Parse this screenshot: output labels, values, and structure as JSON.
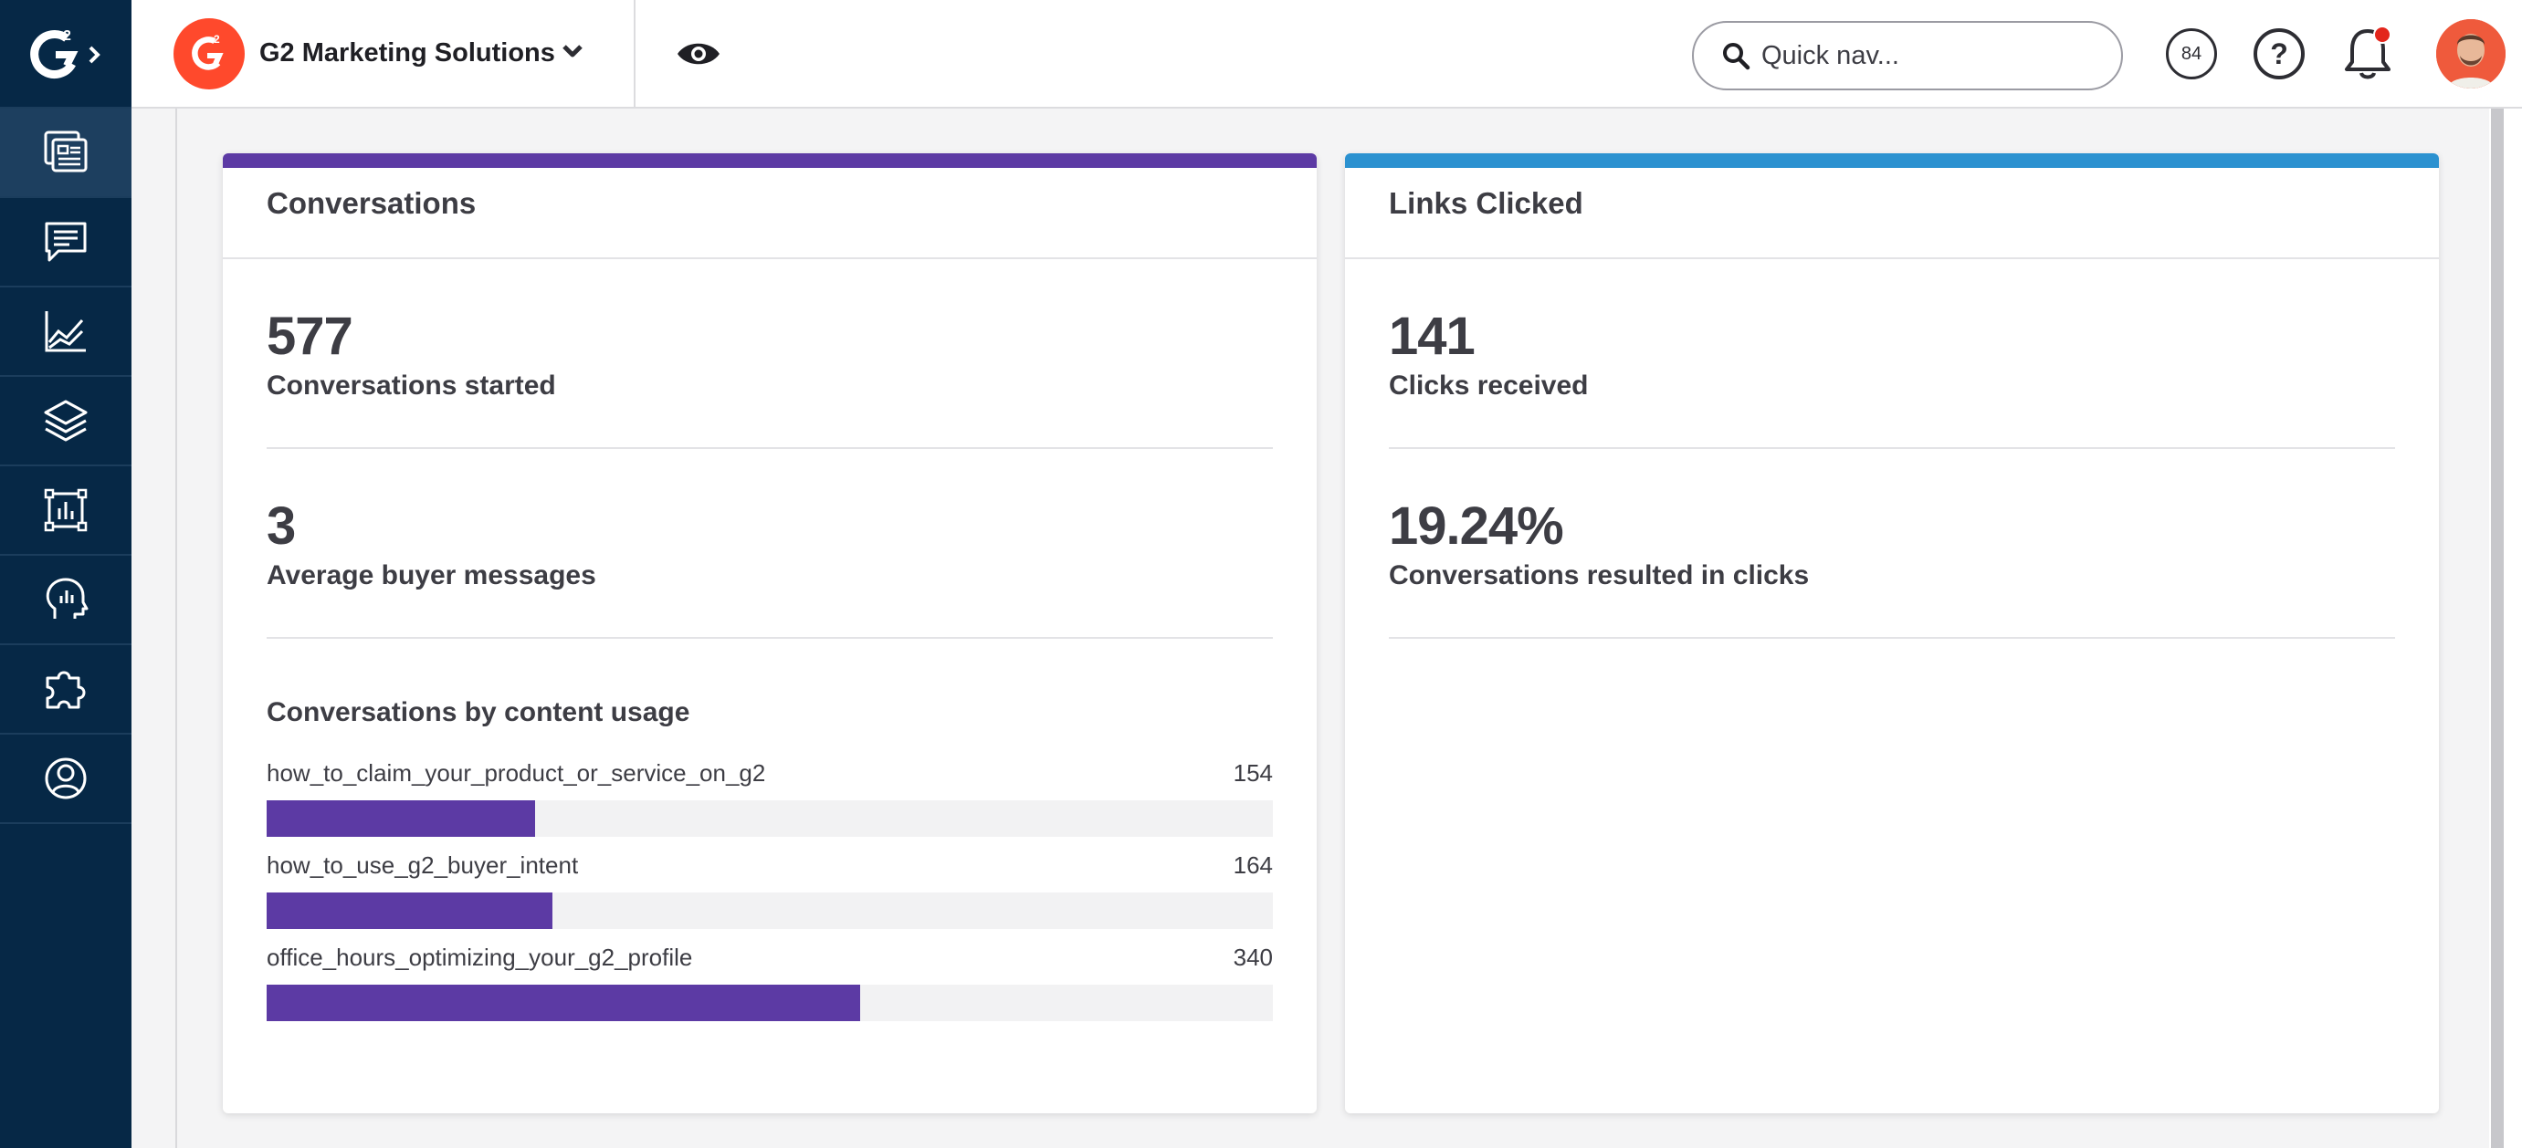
{
  "company": {
    "name": "G2 Marketing Solutions"
  },
  "search": {
    "placeholder": "Quick nav..."
  },
  "header": {
    "score": "84",
    "help": "?"
  },
  "sidebar": {
    "items": [
      {
        "icon": "dashboard-icon"
      },
      {
        "icon": "chat-icon"
      },
      {
        "icon": "line-chart-icon"
      },
      {
        "icon": "layers-icon"
      },
      {
        "icon": "bar-chart-frame-icon"
      },
      {
        "icon": "head-insights-icon"
      },
      {
        "icon": "puzzle-icon"
      },
      {
        "icon": "user-circle-icon"
      }
    ]
  },
  "colors": {
    "conversations_accent": "#5c3aa4",
    "links_accent": "#2b91d0",
    "sidebar": "#062846",
    "brand": "#ff492c"
  },
  "conversations": {
    "title": "Conversations",
    "started_value": "577",
    "started_label": "Conversations started",
    "avg_value": "3",
    "avg_label": "Average buyer messages",
    "usage_title": "Conversations by content usage",
    "usage": [
      {
        "label": "how_to_claim_your_product_or_service_on_g2",
        "value": "154",
        "fraction": 0.267
      },
      {
        "label": "how_to_use_g2_buyer_intent",
        "value": "164",
        "fraction": 0.284
      },
      {
        "label": "office_hours_optimizing_your_g2_profile",
        "value": "340",
        "fraction": 0.59
      }
    ]
  },
  "links": {
    "title": "Links Clicked",
    "clicks_value": "141",
    "clicks_label": "Clicks received",
    "rate_value": "19.24%",
    "rate_label": "Conversations resulted in clicks"
  }
}
